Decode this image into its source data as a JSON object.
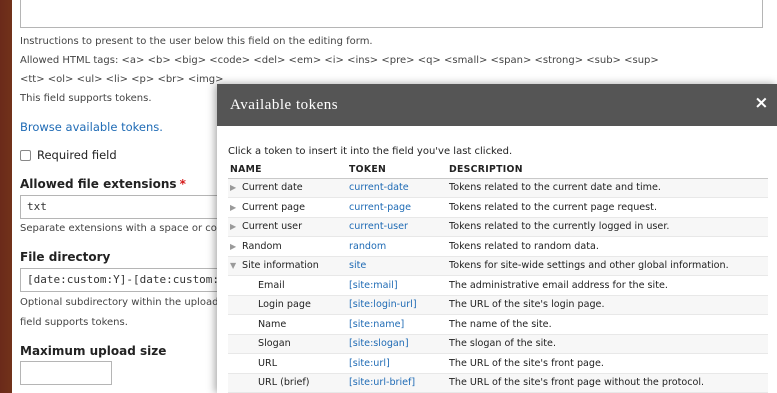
{
  "form": {
    "instructions_help": "Instructions to present to the user below this field on the editing form.",
    "allowed_html": "Allowed HTML tags: <a> <b> <big> <code> <del> <em> <i> <ins> <pre> <q> <small> <span> <strong> <sub> <sup>",
    "allowed_html_2": "<tt> <ol> <ul> <li> <p> <br> <img>",
    "supports_tokens": "This field supports tokens.",
    "browse_tokens_link": "Browse available tokens.",
    "required_label": "Required field",
    "extensions_label": "Allowed file extensions",
    "extensions_required_mark": "*",
    "extensions_value": "txt",
    "extensions_help": "Separate extensions with a space or comma and do not include the leading dot.",
    "directory_label": "File directory",
    "directory_value": "[date:custom:Y]-[date:custom:m]",
    "directory_help": "Optional subdirectory within the upload destination where files will be stored. Do not include preceding or trailing slashes. This",
    "directory_help_2": "field supports tokens.",
    "max_size_label": "Maximum upload size",
    "max_size_value": ""
  },
  "modal": {
    "title": "Available tokens",
    "close_label": "×",
    "instructions": "Click a token to insert it into the field you've last clicked.",
    "columns": [
      "NAME",
      "TOKEN",
      "DESCRIPTION"
    ],
    "rows": [
      {
        "name": "Current date",
        "token": "current-date",
        "description": "Tokens related to the current date and time.",
        "expander": "▶"
      },
      {
        "name": "Current page",
        "token": "current-page",
        "description": "Tokens related to the current page request.",
        "expander": "▶"
      },
      {
        "name": "Current user",
        "token": "current-user",
        "description": "Tokens related to the currently logged in user.",
        "expander": "▶"
      },
      {
        "name": "Random",
        "token": "random",
        "description": "Tokens related to random data.",
        "expander": "▶"
      },
      {
        "name": "Site information",
        "token": "site",
        "description": "Tokens for site-wide settings and other global information.",
        "expander": "▼"
      },
      {
        "name": "Email",
        "token": "[site:mail]",
        "description": "The administrative email address for the site."
      },
      {
        "name": "Login page",
        "token": "[site:login-url]",
        "description": "The URL of the site's login page."
      },
      {
        "name": "Name",
        "token": "[site:name]",
        "description": "The name of the site."
      },
      {
        "name": "Slogan",
        "token": "[site:slogan]",
        "description": "The slogan of the site."
      },
      {
        "name": "URL",
        "token": "[site:url]",
        "description": "The URL of the site's front page."
      },
      {
        "name": "URL (brief)",
        "token": "[site:url-brief]",
        "description": "The URL of the site's front page without the protocol."
      }
    ]
  },
  "colors": {
    "link": "#1f6bb5",
    "modal_header": "#555555",
    "required": "#d61b1b"
  }
}
